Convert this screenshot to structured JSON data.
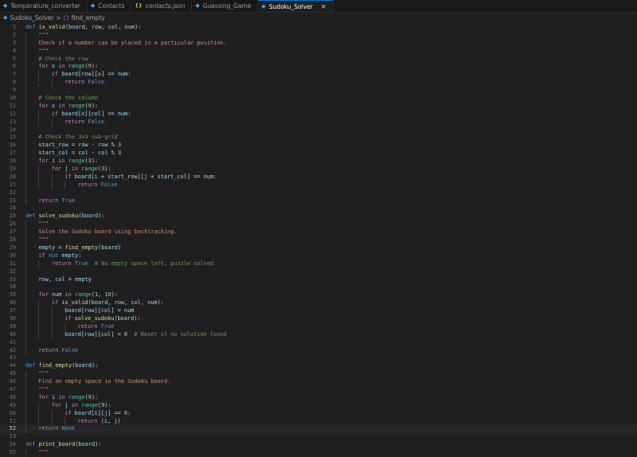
{
  "tabs": [
    {
      "label": "Temperature_converter",
      "icon": "python-file-icon",
      "active": false,
      "italic": false
    },
    {
      "label": "Contacts",
      "icon": "python-file-icon",
      "active": false,
      "italic": false
    },
    {
      "label": "contacts.json",
      "icon": "json-file-icon",
      "active": false,
      "italic": true
    },
    {
      "label": "Guessing_Game",
      "icon": "python-file-icon",
      "active": false,
      "italic": false
    },
    {
      "label": "Sudoku_Solver",
      "icon": "python-file-icon",
      "active": true,
      "italic": false,
      "close": "✕"
    }
  ],
  "breadcrumb": {
    "file": "Sudoku_Solver",
    "separator": ">",
    "symbol": "find_empty"
  },
  "editor": {
    "current_line": 52,
    "lines": [
      {
        "n": "1",
        "indent": 0,
        "tokens": [
          [
            "kw",
            "def "
          ],
          [
            "fn",
            "is_valid"
          ],
          [
            "op",
            "("
          ],
          [
            "param",
            "board"
          ],
          [
            "op",
            ", "
          ],
          [
            "param",
            "row"
          ],
          [
            "op",
            ", "
          ],
          [
            "param",
            "col"
          ],
          [
            "op",
            ", "
          ],
          [
            "param",
            "num"
          ],
          [
            "op",
            "):"
          ]
        ]
      },
      {
        "n": "2",
        "indent": 1,
        "tokens": [
          [
            "str",
            "\"\"\""
          ]
        ]
      },
      {
        "n": "3",
        "indent": 1,
        "tokens": [
          [
            "str",
            "Check if a number can be placed in a particular position."
          ]
        ]
      },
      {
        "n": "4",
        "indent": 1,
        "tokens": [
          [
            "str",
            "\"\"\""
          ]
        ]
      },
      {
        "n": "5",
        "indent": 1,
        "tokens": [
          [
            "cmt",
            "# Check the row"
          ]
        ]
      },
      {
        "n": "6",
        "indent": 1,
        "tokens": [
          [
            "ctl",
            "for "
          ],
          [
            "var",
            "x"
          ],
          [
            "ctl",
            " in "
          ],
          [
            "bi",
            "range"
          ],
          [
            "op",
            "("
          ],
          [
            "num",
            "9"
          ],
          [
            "op",
            "):"
          ]
        ]
      },
      {
        "n": "7",
        "indent": 2,
        "tokens": [
          [
            "ctl",
            "if "
          ],
          [
            "var",
            "board"
          ],
          [
            "op",
            "["
          ],
          [
            "var",
            "row"
          ],
          [
            "op",
            "]["
          ],
          [
            "var",
            "x"
          ],
          [
            "op",
            "] == "
          ],
          [
            "var",
            "num"
          ],
          [
            "op",
            ":"
          ]
        ]
      },
      {
        "n": "8",
        "indent": 3,
        "tokens": [
          [
            "ctl",
            "return "
          ],
          [
            "const",
            "False"
          ]
        ]
      },
      {
        "n": "9",
        "indent": 0,
        "tokens": []
      },
      {
        "n": "10",
        "indent": 1,
        "tokens": [
          [
            "cmt",
            "# Check the column"
          ]
        ]
      },
      {
        "n": "11",
        "indent": 1,
        "tokens": [
          [
            "ctl",
            "for "
          ],
          [
            "var",
            "x"
          ],
          [
            "ctl",
            " in "
          ],
          [
            "bi",
            "range"
          ],
          [
            "op",
            "("
          ],
          [
            "num",
            "9"
          ],
          [
            "op",
            "):"
          ]
        ]
      },
      {
        "n": "12",
        "indent": 2,
        "tokens": [
          [
            "ctl",
            "if "
          ],
          [
            "var",
            "board"
          ],
          [
            "op",
            "["
          ],
          [
            "var",
            "x"
          ],
          [
            "op",
            "]["
          ],
          [
            "var",
            "col"
          ],
          [
            "op",
            "] == "
          ],
          [
            "var",
            "num"
          ],
          [
            "op",
            ":"
          ]
        ]
      },
      {
        "n": "13",
        "indent": 3,
        "tokens": [
          [
            "ctl",
            "return "
          ],
          [
            "const",
            "False"
          ]
        ]
      },
      {
        "n": "14",
        "indent": 0,
        "tokens": []
      },
      {
        "n": "15",
        "indent": 1,
        "tokens": [
          [
            "cmt",
            "# Check the 3x3 sub-grid"
          ]
        ]
      },
      {
        "n": "16",
        "indent": 1,
        "tokens": [
          [
            "var",
            "start_row"
          ],
          [
            "op",
            " = "
          ],
          [
            "var",
            "row"
          ],
          [
            "op",
            " - "
          ],
          [
            "var",
            "row"
          ],
          [
            "op",
            " % "
          ],
          [
            "num",
            "3"
          ]
        ]
      },
      {
        "n": "17",
        "indent": 1,
        "tokens": [
          [
            "var",
            "start_col"
          ],
          [
            "op",
            " = "
          ],
          [
            "var",
            "col"
          ],
          [
            "op",
            " - "
          ],
          [
            "var",
            "col"
          ],
          [
            "op",
            " % "
          ],
          [
            "num",
            "3"
          ]
        ]
      },
      {
        "n": "18",
        "indent": 1,
        "tokens": [
          [
            "ctl",
            "for "
          ],
          [
            "var",
            "i"
          ],
          [
            "ctl",
            " in "
          ],
          [
            "bi",
            "range"
          ],
          [
            "op",
            "("
          ],
          [
            "num",
            "3"
          ],
          [
            "op",
            "):"
          ]
        ]
      },
      {
        "n": "19",
        "indent": 2,
        "tokens": [
          [
            "ctl",
            "for "
          ],
          [
            "var",
            "j"
          ],
          [
            "ctl",
            " in "
          ],
          [
            "bi",
            "range"
          ],
          [
            "op",
            "("
          ],
          [
            "num",
            "3"
          ],
          [
            "op",
            "):"
          ]
        ]
      },
      {
        "n": "20",
        "indent": 3,
        "tokens": [
          [
            "ctl",
            "if "
          ],
          [
            "var",
            "board"
          ],
          [
            "op",
            "["
          ],
          [
            "var",
            "i"
          ],
          [
            "op",
            " + "
          ],
          [
            "var",
            "start_row"
          ],
          [
            "op",
            "]["
          ],
          [
            "var",
            "j"
          ],
          [
            "op",
            " + "
          ],
          [
            "var",
            "start_col"
          ],
          [
            "op",
            "] == "
          ],
          [
            "var",
            "num"
          ],
          [
            "op",
            ":"
          ]
        ]
      },
      {
        "n": "21",
        "indent": 4,
        "tokens": [
          [
            "ctl",
            "return "
          ],
          [
            "const",
            "False"
          ]
        ]
      },
      {
        "n": "22",
        "indent": 0,
        "tokens": []
      },
      {
        "n": "23",
        "indent": 1,
        "tokens": [
          [
            "ctl",
            "return "
          ],
          [
            "const",
            "True"
          ]
        ]
      },
      {
        "n": "24",
        "indent": 0,
        "tokens": []
      },
      {
        "n": "25",
        "indent": 0,
        "tokens": [
          [
            "kw",
            "def "
          ],
          [
            "fn",
            "solve_sudoku"
          ],
          [
            "op",
            "("
          ],
          [
            "param",
            "board"
          ],
          [
            "op",
            "):"
          ]
        ]
      },
      {
        "n": "26",
        "indent": 1,
        "tokens": [
          [
            "str",
            "\"\"\""
          ]
        ]
      },
      {
        "n": "27",
        "indent": 1,
        "tokens": [
          [
            "str",
            "Solve the Sudoku board using backtracking."
          ]
        ]
      },
      {
        "n": "28",
        "indent": 1,
        "tokens": [
          [
            "str",
            "\"\"\""
          ]
        ]
      },
      {
        "n": "29",
        "indent": 1,
        "tokens": [
          [
            "var",
            "empty"
          ],
          [
            "op",
            " = "
          ],
          [
            "fn",
            "find_empty"
          ],
          [
            "op",
            "("
          ],
          [
            "var",
            "board"
          ],
          [
            "op",
            ")"
          ]
        ]
      },
      {
        "n": "30",
        "indent": 1,
        "tokens": [
          [
            "ctl",
            "if "
          ],
          [
            "kw",
            "not "
          ],
          [
            "var",
            "empty"
          ],
          [
            "op",
            ":"
          ]
        ]
      },
      {
        "n": "31",
        "indent": 2,
        "tokens": [
          [
            "ctl",
            "return "
          ],
          [
            "const",
            "True"
          ],
          [
            "op",
            "  "
          ],
          [
            "cmt",
            "# No empty space left, puzzle solved"
          ]
        ]
      },
      {
        "n": "32",
        "indent": 0,
        "tokens": []
      },
      {
        "n": "33",
        "indent": 1,
        "tokens": [
          [
            "var",
            "row"
          ],
          [
            "op",
            ", "
          ],
          [
            "var",
            "col"
          ],
          [
            "op",
            " = "
          ],
          [
            "var",
            "empty"
          ]
        ]
      },
      {
        "n": "34",
        "indent": 0,
        "tokens": []
      },
      {
        "n": "35",
        "indent": 1,
        "tokens": [
          [
            "ctl",
            "for "
          ],
          [
            "var",
            "num"
          ],
          [
            "ctl",
            " in "
          ],
          [
            "bi",
            "range"
          ],
          [
            "op",
            "("
          ],
          [
            "num",
            "1"
          ],
          [
            "op",
            ", "
          ],
          [
            "num",
            "10"
          ],
          [
            "op",
            "):"
          ]
        ]
      },
      {
        "n": "36",
        "indent": 2,
        "tokens": [
          [
            "ctl",
            "if "
          ],
          [
            "fn",
            "is_valid"
          ],
          [
            "op",
            "("
          ],
          [
            "var",
            "board"
          ],
          [
            "op",
            ", "
          ],
          [
            "var",
            "row"
          ],
          [
            "op",
            ", "
          ],
          [
            "var",
            "col"
          ],
          [
            "op",
            ", "
          ],
          [
            "var",
            "num"
          ],
          [
            "op",
            "):"
          ]
        ]
      },
      {
        "n": "37",
        "indent": 3,
        "tokens": [
          [
            "var",
            "board"
          ],
          [
            "op",
            "["
          ],
          [
            "var",
            "row"
          ],
          [
            "op",
            "]["
          ],
          [
            "var",
            "col"
          ],
          [
            "op",
            "] = "
          ],
          [
            "var",
            "num"
          ]
        ]
      },
      {
        "n": "38",
        "indent": 3,
        "tokens": [
          [
            "ctl",
            "if "
          ],
          [
            "fn",
            "solve_sudoku"
          ],
          [
            "op",
            "("
          ],
          [
            "var",
            "board"
          ],
          [
            "op",
            "):"
          ]
        ]
      },
      {
        "n": "39",
        "indent": 4,
        "tokens": [
          [
            "ctl",
            "return "
          ],
          [
            "const",
            "True"
          ]
        ]
      },
      {
        "n": "40",
        "indent": 3,
        "tokens": [
          [
            "var",
            "board"
          ],
          [
            "op",
            "["
          ],
          [
            "var",
            "row"
          ],
          [
            "op",
            "]["
          ],
          [
            "var",
            "col"
          ],
          [
            "op",
            "] = "
          ],
          [
            "num",
            "0"
          ],
          [
            "op",
            "  "
          ],
          [
            "cmt",
            "# Reset if no solution found"
          ]
        ]
      },
      {
        "n": "41",
        "indent": 0,
        "tokens": []
      },
      {
        "n": "42",
        "indent": 1,
        "tokens": [
          [
            "ctl",
            "return "
          ],
          [
            "const",
            "False"
          ]
        ]
      },
      {
        "n": "43",
        "indent": 0,
        "tokens": []
      },
      {
        "n": "44",
        "indent": 0,
        "tokens": [
          [
            "kw",
            "def "
          ],
          [
            "fn",
            "find_empty"
          ],
          [
            "op",
            "("
          ],
          [
            "param",
            "board"
          ],
          [
            "op",
            "):"
          ]
        ]
      },
      {
        "n": "45",
        "indent": 1,
        "tokens": [
          [
            "str",
            "\"\"\""
          ]
        ]
      },
      {
        "n": "46",
        "indent": 1,
        "tokens": [
          [
            "str",
            "Find an empty space in the Sudoku board."
          ]
        ]
      },
      {
        "n": "47",
        "indent": 1,
        "tokens": [
          [
            "str",
            "\"\"\""
          ]
        ]
      },
      {
        "n": "48",
        "indent": 1,
        "tokens": [
          [
            "ctl",
            "for "
          ],
          [
            "var",
            "i"
          ],
          [
            "ctl",
            " in "
          ],
          [
            "bi",
            "range"
          ],
          [
            "op",
            "("
          ],
          [
            "num",
            "9"
          ],
          [
            "op",
            "):"
          ]
        ]
      },
      {
        "n": "49",
        "indent": 2,
        "tokens": [
          [
            "ctl",
            "for "
          ],
          [
            "var",
            "j"
          ],
          [
            "ctl",
            " in "
          ],
          [
            "bi",
            "range"
          ],
          [
            "op",
            "("
          ],
          [
            "num",
            "9"
          ],
          [
            "op",
            "):"
          ]
        ]
      },
      {
        "n": "50",
        "indent": 3,
        "tokens": [
          [
            "ctl",
            "if "
          ],
          [
            "var",
            "board"
          ],
          [
            "op",
            "["
          ],
          [
            "var",
            "i"
          ],
          [
            "op",
            "]["
          ],
          [
            "var",
            "j"
          ],
          [
            "op",
            "] == "
          ],
          [
            "num",
            "0"
          ],
          [
            "op",
            ":"
          ]
        ]
      },
      {
        "n": "51",
        "indent": 4,
        "tokens": [
          [
            "ctl",
            "return "
          ],
          [
            "op",
            "("
          ],
          [
            "var",
            "i"
          ],
          [
            "op",
            ", "
          ],
          [
            "var",
            "j"
          ],
          [
            "op",
            ")"
          ]
        ]
      },
      {
        "n": "52",
        "indent": 1,
        "tokens": [
          [
            "ctl",
            "return "
          ],
          [
            "const",
            "None"
          ]
        ]
      },
      {
        "n": "53",
        "indent": 0,
        "tokens": []
      },
      {
        "n": "54",
        "indent": 0,
        "tokens": [
          [
            "kw",
            "def "
          ],
          [
            "fn",
            "print_board"
          ],
          [
            "op",
            "("
          ],
          [
            "param",
            "board"
          ],
          [
            "op",
            "):"
          ]
        ]
      },
      {
        "n": "55",
        "indent": 1,
        "tokens": [
          [
            "str",
            "\"\"\""
          ]
        ]
      }
    ]
  }
}
